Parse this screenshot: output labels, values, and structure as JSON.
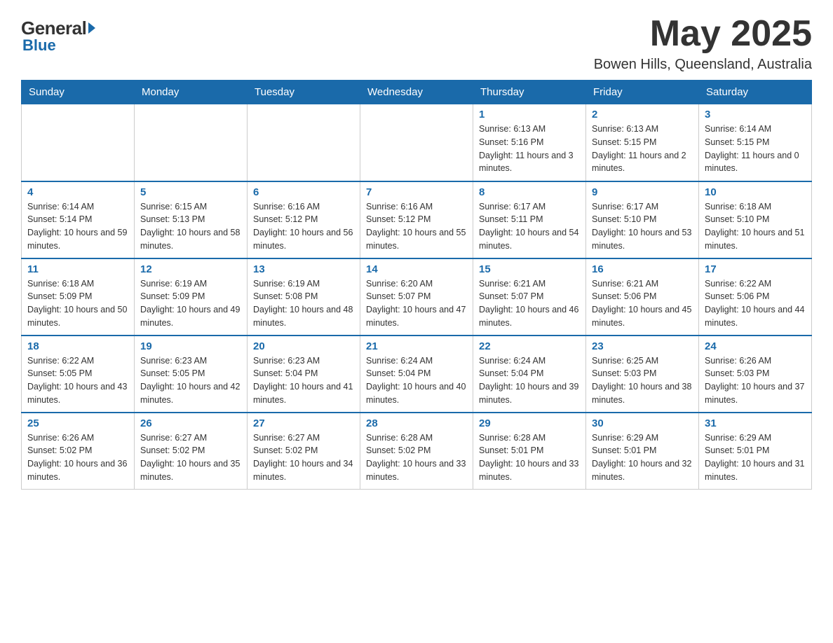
{
  "logo": {
    "general": "General",
    "blue": "Blue"
  },
  "title": {
    "month_year": "May 2025",
    "location": "Bowen Hills, Queensland, Australia"
  },
  "weekdays": [
    "Sunday",
    "Monday",
    "Tuesday",
    "Wednesday",
    "Thursday",
    "Friday",
    "Saturday"
  ],
  "weeks": [
    [
      {
        "day": "",
        "info": ""
      },
      {
        "day": "",
        "info": ""
      },
      {
        "day": "",
        "info": ""
      },
      {
        "day": "",
        "info": ""
      },
      {
        "day": "1",
        "info": "Sunrise: 6:13 AM\nSunset: 5:16 PM\nDaylight: 11 hours and 3 minutes."
      },
      {
        "day": "2",
        "info": "Sunrise: 6:13 AM\nSunset: 5:15 PM\nDaylight: 11 hours and 2 minutes."
      },
      {
        "day": "3",
        "info": "Sunrise: 6:14 AM\nSunset: 5:15 PM\nDaylight: 11 hours and 0 minutes."
      }
    ],
    [
      {
        "day": "4",
        "info": "Sunrise: 6:14 AM\nSunset: 5:14 PM\nDaylight: 10 hours and 59 minutes."
      },
      {
        "day": "5",
        "info": "Sunrise: 6:15 AM\nSunset: 5:13 PM\nDaylight: 10 hours and 58 minutes."
      },
      {
        "day": "6",
        "info": "Sunrise: 6:16 AM\nSunset: 5:12 PM\nDaylight: 10 hours and 56 minutes."
      },
      {
        "day": "7",
        "info": "Sunrise: 6:16 AM\nSunset: 5:12 PM\nDaylight: 10 hours and 55 minutes."
      },
      {
        "day": "8",
        "info": "Sunrise: 6:17 AM\nSunset: 5:11 PM\nDaylight: 10 hours and 54 minutes."
      },
      {
        "day": "9",
        "info": "Sunrise: 6:17 AM\nSunset: 5:10 PM\nDaylight: 10 hours and 53 minutes."
      },
      {
        "day": "10",
        "info": "Sunrise: 6:18 AM\nSunset: 5:10 PM\nDaylight: 10 hours and 51 minutes."
      }
    ],
    [
      {
        "day": "11",
        "info": "Sunrise: 6:18 AM\nSunset: 5:09 PM\nDaylight: 10 hours and 50 minutes."
      },
      {
        "day": "12",
        "info": "Sunrise: 6:19 AM\nSunset: 5:09 PM\nDaylight: 10 hours and 49 minutes."
      },
      {
        "day": "13",
        "info": "Sunrise: 6:19 AM\nSunset: 5:08 PM\nDaylight: 10 hours and 48 minutes."
      },
      {
        "day": "14",
        "info": "Sunrise: 6:20 AM\nSunset: 5:07 PM\nDaylight: 10 hours and 47 minutes."
      },
      {
        "day": "15",
        "info": "Sunrise: 6:21 AM\nSunset: 5:07 PM\nDaylight: 10 hours and 46 minutes."
      },
      {
        "day": "16",
        "info": "Sunrise: 6:21 AM\nSunset: 5:06 PM\nDaylight: 10 hours and 45 minutes."
      },
      {
        "day": "17",
        "info": "Sunrise: 6:22 AM\nSunset: 5:06 PM\nDaylight: 10 hours and 44 minutes."
      }
    ],
    [
      {
        "day": "18",
        "info": "Sunrise: 6:22 AM\nSunset: 5:05 PM\nDaylight: 10 hours and 43 minutes."
      },
      {
        "day": "19",
        "info": "Sunrise: 6:23 AM\nSunset: 5:05 PM\nDaylight: 10 hours and 42 minutes."
      },
      {
        "day": "20",
        "info": "Sunrise: 6:23 AM\nSunset: 5:04 PM\nDaylight: 10 hours and 41 minutes."
      },
      {
        "day": "21",
        "info": "Sunrise: 6:24 AM\nSunset: 5:04 PM\nDaylight: 10 hours and 40 minutes."
      },
      {
        "day": "22",
        "info": "Sunrise: 6:24 AM\nSunset: 5:04 PM\nDaylight: 10 hours and 39 minutes."
      },
      {
        "day": "23",
        "info": "Sunrise: 6:25 AM\nSunset: 5:03 PM\nDaylight: 10 hours and 38 minutes."
      },
      {
        "day": "24",
        "info": "Sunrise: 6:26 AM\nSunset: 5:03 PM\nDaylight: 10 hours and 37 minutes."
      }
    ],
    [
      {
        "day": "25",
        "info": "Sunrise: 6:26 AM\nSunset: 5:02 PM\nDaylight: 10 hours and 36 minutes."
      },
      {
        "day": "26",
        "info": "Sunrise: 6:27 AM\nSunset: 5:02 PM\nDaylight: 10 hours and 35 minutes."
      },
      {
        "day": "27",
        "info": "Sunrise: 6:27 AM\nSunset: 5:02 PM\nDaylight: 10 hours and 34 minutes."
      },
      {
        "day": "28",
        "info": "Sunrise: 6:28 AM\nSunset: 5:02 PM\nDaylight: 10 hours and 33 minutes."
      },
      {
        "day": "29",
        "info": "Sunrise: 6:28 AM\nSunset: 5:01 PM\nDaylight: 10 hours and 33 minutes."
      },
      {
        "day": "30",
        "info": "Sunrise: 6:29 AM\nSunset: 5:01 PM\nDaylight: 10 hours and 32 minutes."
      },
      {
        "day": "31",
        "info": "Sunrise: 6:29 AM\nSunset: 5:01 PM\nDaylight: 10 hours and 31 minutes."
      }
    ]
  ]
}
